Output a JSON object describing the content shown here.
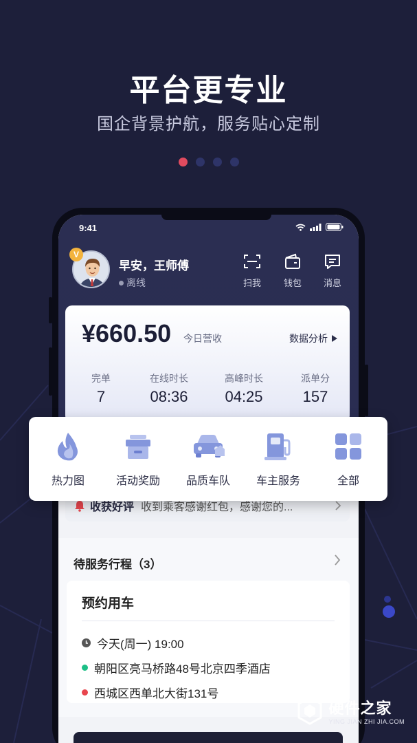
{
  "hero": {
    "title": "平台更专业",
    "subtitle": "国企背景护航，服务贴心定制",
    "pager_total": 4,
    "pager_active": 1
  },
  "status_bar": {
    "time": "9:41"
  },
  "driver": {
    "greeting": "早安，王师傅",
    "status": "离线",
    "badge": "V"
  },
  "top_actions": [
    {
      "label": "扫我",
      "icon": "scan-icon"
    },
    {
      "label": "钱包",
      "icon": "wallet-icon"
    },
    {
      "label": "消息",
      "icon": "message-icon"
    }
  ],
  "income": {
    "amount": "¥660.50",
    "label": "今日营收",
    "analysis_link": "数据分析"
  },
  "stats": [
    {
      "key": "完单",
      "value": "7"
    },
    {
      "key": "在线时长",
      "value": "08:36"
    },
    {
      "key": "高峰时长",
      "value": "04:25"
    },
    {
      "key": "派单分",
      "value": "157"
    }
  ],
  "quick_menu": [
    {
      "label": "热力图",
      "icon": "flame-icon"
    },
    {
      "label": "活动奖励",
      "icon": "gift-icon"
    },
    {
      "label": "品质车队",
      "icon": "car-icon"
    },
    {
      "label": "车主服务",
      "icon": "fuel-pump-icon"
    },
    {
      "label": "全部",
      "icon": "grid-icon"
    }
  ],
  "notice": {
    "title": "收获好评",
    "text": "收到乘客感谢红包，感谢您的..."
  },
  "trips": {
    "header": "待服务行程（3）",
    "card": {
      "type": "预约用车",
      "time": "今天(周一) 19:00",
      "from": "朝阳区亮马桥路48号北京四季酒店",
      "to": "西城区西单北大街131号"
    }
  },
  "watermark": {
    "main": "硬件之家",
    "sub": "YING JIAN ZHI JIA.COM"
  },
  "colors": {
    "background": "#1d1f3a",
    "accent_red": "#e14b5f",
    "pager_inactive": "#2e3468",
    "green": "#1cbf86",
    "quick_icon": "#7f8fd6"
  }
}
